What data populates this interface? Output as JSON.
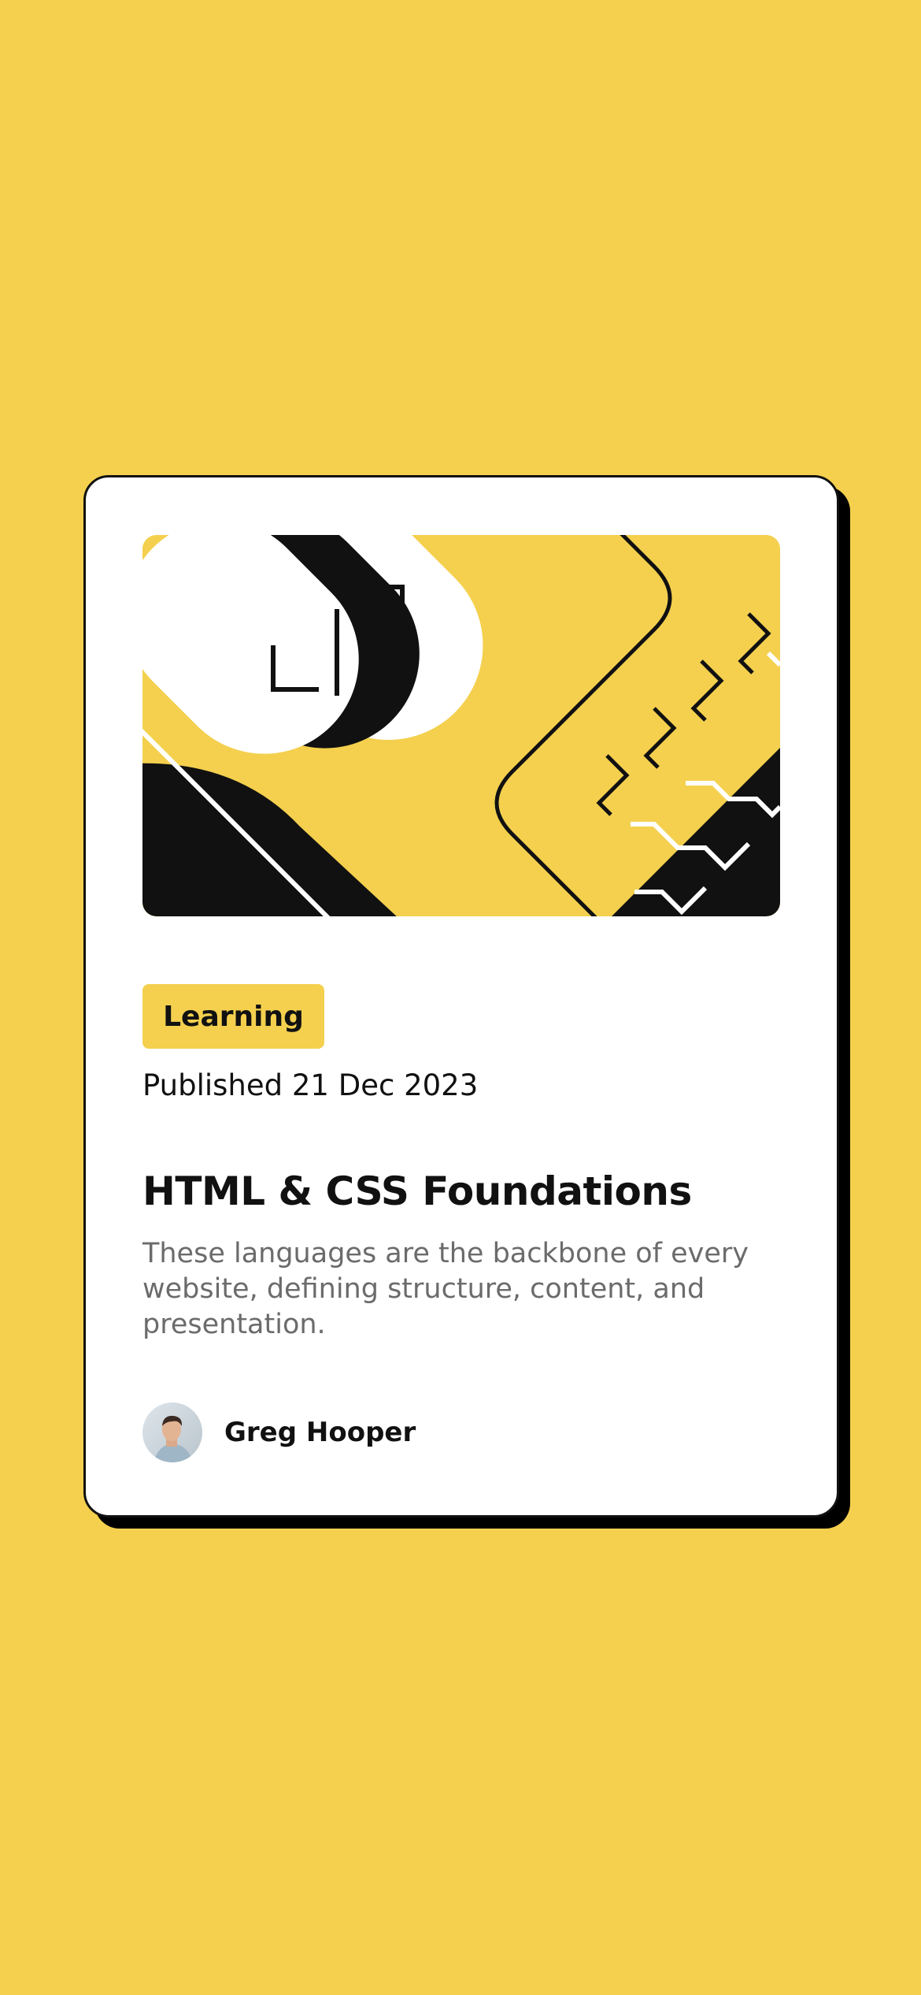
{
  "card": {
    "tag": "Learning",
    "published": "Published 21 Dec 2023",
    "title": "HTML & CSS Foundations",
    "description": "These languages are the backbone of every website, defining structure, content, and presentation.",
    "author": {
      "name": "Greg Hooper",
      "avatar_icon": "avatar-photo"
    },
    "illustration_icon": "abstract-illustration"
  },
  "colors": {
    "background": "#F4D04E",
    "card": "#FFFFFF",
    "ink": "#111111",
    "muted": "#6B6B6B"
  }
}
